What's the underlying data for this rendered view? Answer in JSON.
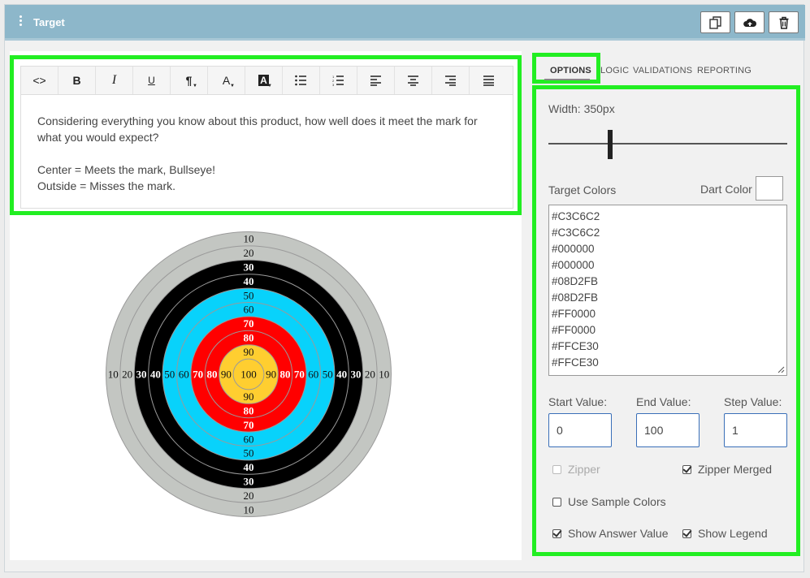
{
  "header": {
    "title": "Target",
    "actions": [
      "copy-icon",
      "cloud-upload-icon",
      "trash-icon"
    ]
  },
  "editor": {
    "toolbar": [
      "code-view",
      "bold",
      "italic",
      "underline",
      "paragraph",
      "font-color",
      "background-color",
      "bulleted-list",
      "numbered-list",
      "align-left",
      "align-center",
      "align-right",
      "justify"
    ],
    "bold_label": "B",
    "italic_label": "I",
    "underline_label": "U",
    "code_label": "<>",
    "paragraph_label": "¶",
    "fontcolor_label": "A",
    "bgcolor_label": "A",
    "line1": "Considering everything you know about this product, how well does it meet the mark for what you would expect?",
    "line2": "Center = Meets the mark, Bullseye!",
    "line3": "Outside = Misses the mark."
  },
  "target": {
    "rings": [
      {
        "value": "10",
        "color": "#C3C6C2",
        "text_color": "#111"
      },
      {
        "value": "20",
        "color": "#C3C6C2",
        "text_color": "#111"
      },
      {
        "value": "30",
        "color": "#000000",
        "text_color": "#fff"
      },
      {
        "value": "40",
        "color": "#000000",
        "text_color": "#fff"
      },
      {
        "value": "50",
        "color": "#08D2FB",
        "text_color": "#111"
      },
      {
        "value": "60",
        "color": "#08D2FB",
        "text_color": "#111"
      },
      {
        "value": "70",
        "color": "#FF0000",
        "text_color": "#fff"
      },
      {
        "value": "80",
        "color": "#FF0000",
        "text_color": "#fff"
      },
      {
        "value": "90",
        "color": "#FFCE30",
        "text_color": "#111"
      },
      {
        "value": "100",
        "color": "#FFCE30",
        "text_color": "#111"
      }
    ]
  },
  "tabs": {
    "options": "OPTIONS",
    "logic": "LOGIC",
    "validations": "VALIDATIONS",
    "reporting": "REPORTING"
  },
  "options": {
    "width_label": "Width: 350px",
    "width_value": 350,
    "target_colors_label": "Target Colors",
    "dart_color_label": "Dart Color",
    "dart_color": "#FFFFFF",
    "colors": [
      "#C3C6C2",
      "#C3C6C2",
      "#000000",
      "#000000",
      "#08D2FB",
      "#08D2FB",
      "#FF0000",
      "#FF0000",
      "#FFCE30",
      "#FFCE30"
    ],
    "start_label": "Start Value:",
    "end_label": "End Value:",
    "step_label": "Step Value:",
    "start_value": "0",
    "end_value": "100",
    "step_value": "1",
    "zipper_label": "Zipper",
    "zipper_merged_label": "Zipper Merged",
    "use_sample_colors_label": "Use Sample Colors",
    "show_answer_value_label": "Show Answer Value",
    "show_legend_label": "Show Legend",
    "zipper_checked": false,
    "zipper_merged_checked": true,
    "use_sample_colors_checked": false,
    "show_answer_value_checked": true,
    "show_legend_checked": true
  }
}
